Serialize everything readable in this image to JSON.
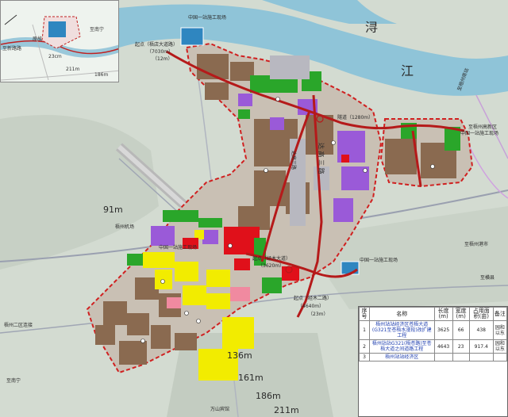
{
  "river": {
    "name_1": "浔",
    "name_2": "江",
    "name_3": "浔"
  },
  "elevations": {
    "e1": "91m",
    "e2": "136m",
    "e3": "161m",
    "e4": "186m",
    "e5": "211m"
  },
  "inset": {
    "name": "原故",
    "scale_1": "23cm",
    "scale_2": "211m",
    "scale_3": "186m",
    "road_1": "至南宁",
    "road_2": "至新路路"
  },
  "labels": {
    "airport": "梧州机场",
    "bridge_1": "起点（梧店大道路）",
    "bridge_1_len": "（7030m）",
    "bridge_1_width": "（12m）",
    "park_north": "中国一站施工现场",
    "park_east": "中国一站施工现场",
    "park_south": "中国一站施工现场",
    "park_mid": "中国一站施工现场",
    "road_length": "隧道（1280m）",
    "start_point": "起点（经木大道）",
    "start_len": "（3620m）",
    "end_point": "起点（经木二路）",
    "end_len": "（4640m）",
    "end_width": "（23m）",
    "zone_vertical": "达 高 三 路",
    "zone_vertical_2": "达高三路",
    "east_road": "至梧州港市",
    "yushui": "至梧州高新区",
    "south_link": "至南宁",
    "west_road": "梧州二区连接",
    "hengan": "至横县",
    "rail": "至梧州南站",
    "wanshan": "万山宾馆"
  },
  "table": {
    "headers": [
      "序号",
      "名称",
      "长度(m)",
      "宽度(m)",
      "占用面积(亩)",
      "备注"
    ],
    "rows": [
      {
        "no": "1",
        "name": "梧州站站经济区苍梧大道(G321至苍梧水漫段)改扩建工程",
        "length": "3625",
        "width": "66",
        "area": "438",
        "note": "园和以东"
      },
      {
        "no": "2",
        "name": "梧州站站G321(梧苍路)至苍梧大道之间道路工程",
        "length": "4643",
        "width": "23",
        "area": "917.4",
        "note": "园和以东"
      },
      {
        "no": "3",
        "name": "梧州站站经济区",
        "length": "",
        "width": "",
        "area": "",
        "note": ""
      }
    ]
  },
  "colors": {
    "commercial": "#e0101a",
    "residential": "#f2ec00",
    "industrial": "#8a6a50",
    "education": "#9a5ad8",
    "green": "#2aa62a",
    "water": "#2f86c0",
    "boundary": "#d02020",
    "road": "#b51a1a"
  }
}
